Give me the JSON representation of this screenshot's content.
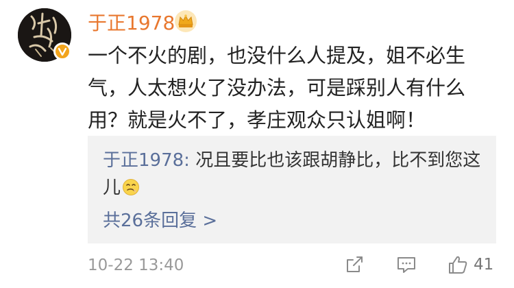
{
  "comment": {
    "username": "于正1978",
    "text": "一个不火的剧，也没什么人提及，姐不必生气，人太想火了没办法，可是踩别人有什么用？就是火不了，孝庄观众只认姐啊！",
    "timestamp": "10-22 13:40",
    "like_count": "41"
  },
  "reply": {
    "username": "于正1978",
    "separator": ": ",
    "text": "况且要比也该跟胡静比，比不到您这儿",
    "more_label": "共26条回复 >"
  },
  "avatar": {
    "artwork_text": "延禧攻略"
  },
  "icons": {
    "crown": "crown-icon",
    "verified": "verified-v-icon",
    "emoji": "wry-smile-emoji",
    "share": "share-icon",
    "comment": "comment-icon",
    "like": "thumbs-up-icon"
  },
  "colors": {
    "username": "#e8772e",
    "link": "#5a6f9a",
    "badge": "#f2a41c",
    "reply_bg": "#f2f2f2",
    "muted": "#999999"
  }
}
